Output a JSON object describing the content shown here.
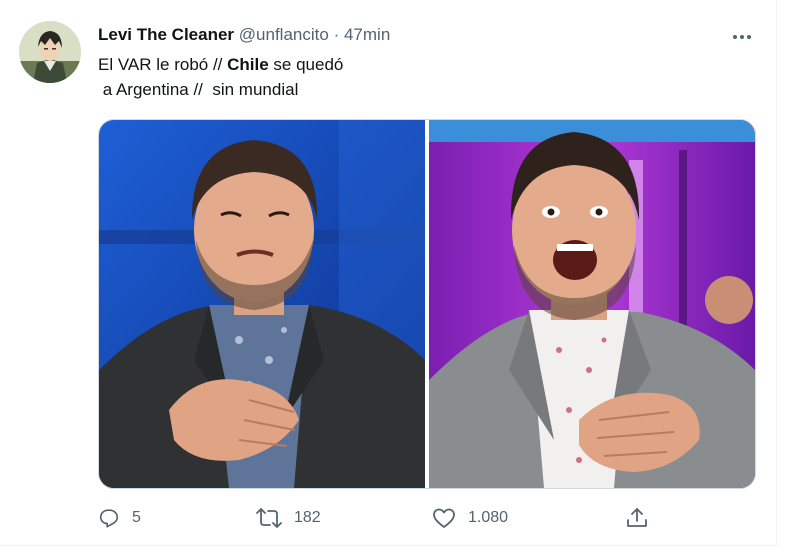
{
  "tweet": {
    "author_name": "Levi The Cleaner",
    "author_handle": "@unflancito",
    "separator": "·",
    "time": "47min",
    "text_line1_a": "El VAR le robó // ",
    "text_line1_bold": "Chile",
    "text_line1_b": " se quedó",
    "text_line2": " a Argentina //  sin mundial",
    "avatar_icon": "anime-character-avatar",
    "more_icon": "more-dots-icon",
    "media": [
      {
        "name": "photo-left",
        "description_icon": "man-sad-face-photo"
      },
      {
        "name": "photo-right",
        "description_icon": "man-laughing-photo"
      }
    ]
  },
  "actions": {
    "reply_count": "5",
    "retweet_count": "182",
    "like_count": "1.080",
    "reply_icon": "reply-icon",
    "retweet_icon": "retweet-icon",
    "like_icon": "heart-icon",
    "share_icon": "share-icon"
  },
  "colors": {
    "text_primary": "#0f1419",
    "text_secondary": "#536471",
    "border": "#cfd9de"
  }
}
